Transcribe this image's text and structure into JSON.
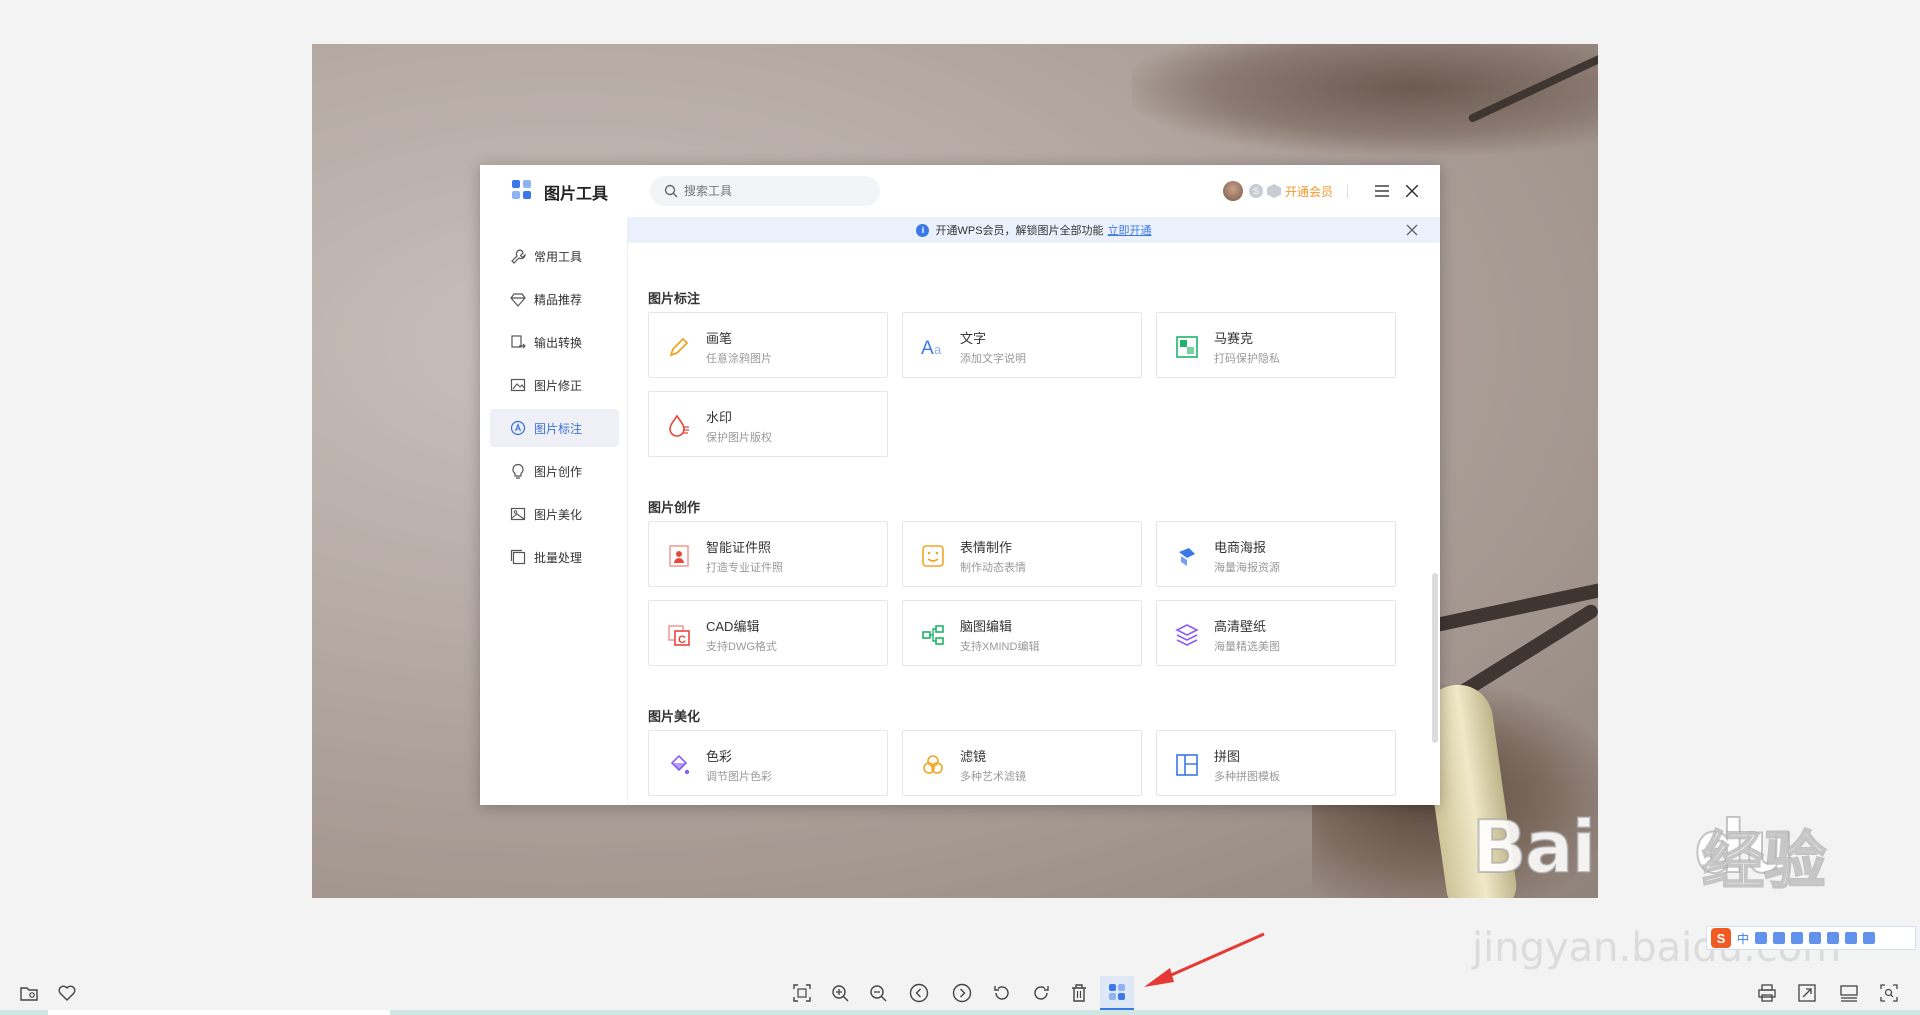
{
  "dialog": {
    "title": "图片工具",
    "search_placeholder": "搜索工具",
    "vip_label": "开通会员"
  },
  "sidebar": {
    "items": [
      {
        "label": "常用工具",
        "icon": "wrench-icon",
        "active": false
      },
      {
        "label": "精品推荐",
        "icon": "diamond-icon",
        "active": false
      },
      {
        "label": "输出转换",
        "icon": "convert-icon",
        "active": false
      },
      {
        "label": "图片修正",
        "icon": "image-fix-icon",
        "active": false
      },
      {
        "label": "图片标注",
        "icon": "annotate-icon",
        "active": true
      },
      {
        "label": "图片创作",
        "icon": "bulb-icon",
        "active": false
      },
      {
        "label": "图片美化",
        "icon": "image-beautify-icon",
        "active": false
      },
      {
        "label": "批量处理",
        "icon": "batch-icon",
        "active": false
      }
    ]
  },
  "banner": {
    "text": "开通WPS会员，解锁图片全部功能",
    "link": "立即开通"
  },
  "sections": [
    {
      "title": "图片标注",
      "tools": [
        {
          "name": "画笔",
          "desc": "任意涂鸦图片",
          "icon": "pen-icon",
          "color": "#f0a623"
        },
        {
          "name": "文字",
          "desc": "添加文字说明",
          "icon": "text-icon",
          "color": "#3b78e7"
        },
        {
          "name": "马赛克",
          "desc": "打码保护隐私",
          "icon": "mosaic-icon",
          "color": "#1fb36b"
        },
        {
          "name": "水印",
          "desc": "保护图片版权",
          "icon": "watermark-icon",
          "color": "#e8463c"
        }
      ]
    },
    {
      "title": "图片创作",
      "tools": [
        {
          "name": "智能证件照",
          "desc": "打造专业证件照",
          "icon": "id-photo-icon",
          "color": "#e8463c"
        },
        {
          "name": "表情制作",
          "desc": "制作动态表情",
          "icon": "emoji-icon",
          "color": "#f0a623"
        },
        {
          "name": "电商海报",
          "desc": "海量海报资源",
          "icon": "poster-icon",
          "color": "#3b78e7"
        },
        {
          "name": "CAD编辑",
          "desc": "支持DWG格式",
          "icon": "cad-icon",
          "color": "#e8463c"
        },
        {
          "name": "脑图编辑",
          "desc": "支持XMIND编辑",
          "icon": "mindmap-icon",
          "color": "#1fb36b"
        },
        {
          "name": "高清壁纸",
          "desc": "海量精选美图",
          "icon": "wallpaper-icon",
          "color": "#8b5cf6"
        }
      ]
    },
    {
      "title": "图片美化",
      "tools": [
        {
          "name": "色彩",
          "desc": "调节图片色彩",
          "icon": "color-icon",
          "color": "#8b5cf6"
        },
        {
          "name": "滤镜",
          "desc": "多种艺术滤镜",
          "icon": "filter-icon",
          "color": "#f0a623"
        },
        {
          "name": "拼图",
          "desc": "多种拼图模板",
          "icon": "collage-icon",
          "color": "#3b78e7"
        }
      ]
    }
  ],
  "watermark": {
    "brand": "Bai",
    "brand2": "du",
    "cn": "经验",
    "url": "jingyan.baidu.com"
  },
  "ime": {
    "logo": "S",
    "lang": "中"
  },
  "colors": {
    "accent": "#3b78e7",
    "vip": "#f29a2e",
    "arrow": "#e53935"
  }
}
